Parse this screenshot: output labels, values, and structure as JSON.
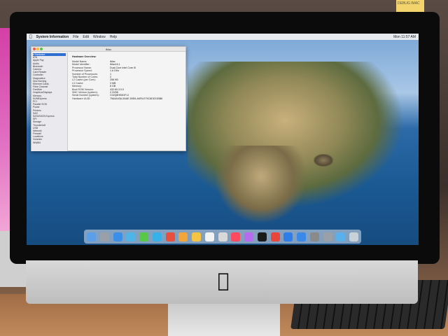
{
  "menubar": {
    "app": "System Information",
    "items": [
      "File",
      "Edit",
      "Window",
      "Help"
    ],
    "clock": "Mon 11:57 AM"
  },
  "window": {
    "title": "iMac",
    "sidebar_items": [
      "Hardware",
      "ATA",
      "Apple Pay",
      "Audio",
      "Bluetooth",
      "Camera",
      "Card Reader",
      "Controller",
      "Diagnostics",
      "Disc Burning",
      "Ethernet Cards",
      "Fibre Channel",
      "FireWire",
      "Graphics/Displays",
      "Memory",
      "NVMExpress",
      "PCI",
      "Parallel SCSI",
      "Power",
      "Printers",
      "SAS",
      "SATA/SATA Express",
      "SPI",
      "Storage",
      "Thunderbolt",
      "USB",
      "Network",
      "Firewall",
      "Locations",
      "Volumes",
      "WWAN"
    ],
    "selected_index": 0,
    "detail_header": "Hardware Overview:",
    "rows": [
      {
        "k": "Model Name:",
        "v": "iMac"
      },
      {
        "k": "Model Identifier:",
        "v": "iMac16,1"
      },
      {
        "k": "Processor Name:",
        "v": "Dual-Core Intel Core i5"
      },
      {
        "k": "Processor Speed:",
        "v": "1.6 GHz"
      },
      {
        "k": "Number of Processors:",
        "v": "1"
      },
      {
        "k": "Total Number of Cores:",
        "v": "2"
      },
      {
        "k": "L2 Cache (per Core):",
        "v": "256 KB"
      },
      {
        "k": "L3 Cache:",
        "v": "3 MB"
      },
      {
        "k": "Memory:",
        "v": "8 GB"
      },
      {
        "k": "Boot ROM Version:",
        "v": "432.60.3.0.0"
      },
      {
        "k": "SMC Version (system):",
        "v": "2.31f36"
      },
      {
        "k": "Serial Number (system):",
        "v": "C02Q8HE8GF1J"
      },
      {
        "k": "Hardware UUID:",
        "v": "75A4A43A-5AAE-50E6-A6F6-E79C8DD31BB6"
      }
    ]
  },
  "sticky_note": "DEBUG IMAC",
  "dock_colors": [
    "#5b9fe8",
    "#9aa0a8",
    "#3c8fe6",
    "#4fb4e8",
    "#59c84a",
    "#38b0ea",
    "#e7503c",
    "#f2a53a",
    "#f6c445",
    "#f2f2f2",
    "#d8d8d8",
    "#fa4a60",
    "#b86bf0",
    "#1a1a1a",
    "#e8453c",
    "#2f7de8",
    "#3a88e8",
    "#8a8a8a",
    "#9aa0a8",
    "#5ab0ea",
    "#c8d0d8"
  ]
}
